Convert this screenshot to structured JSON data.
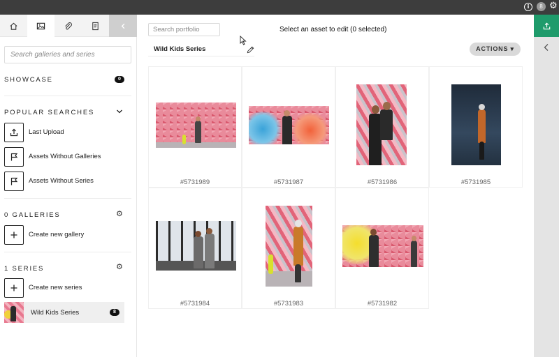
{
  "topbar": {
    "notification_count": "8",
    "icons": [
      "info-icon",
      "notification-badge",
      "gear-icon"
    ]
  },
  "sidebar": {
    "tabs": [
      "home-icon",
      "image-icon",
      "attachment-icon",
      "document-icon",
      "chevron-left-icon"
    ],
    "search_placeholder": "Search galleries and series",
    "showcase": {
      "title": "SHOWCASE",
      "count": "0"
    },
    "popular_searches": {
      "title": "POPULAR SEARCHES",
      "items": [
        {
          "label": "Last Upload",
          "icon": "upload-icon"
        },
        {
          "label": "Assets Without Galleries",
          "icon": "flag-icon"
        },
        {
          "label": "Assets Without Series",
          "icon": "flag-icon"
        }
      ]
    },
    "galleries": {
      "title": "0 GALLERIES",
      "create_label": "Create new gallery"
    },
    "series": {
      "title": "1 SERIES",
      "create_label": "Create new series",
      "items": [
        {
          "label": "Wild Kids Series",
          "count": "8"
        }
      ]
    }
  },
  "main": {
    "search_placeholder": "Search portfolio",
    "selection_message": "Select an asset to edit (0 selected)",
    "series_name": "Wild Kids Series",
    "actions_label": "ACTIONS ▾",
    "assets": [
      {
        "id": "#5731989"
      },
      {
        "id": "#5731987"
      },
      {
        "id": "#5731986"
      },
      {
        "id": "#5731985"
      },
      {
        "id": "#5731984"
      },
      {
        "id": "#5731983"
      },
      {
        "id": "#5731982"
      }
    ]
  },
  "rail": {
    "icons": [
      "upload-icon",
      "chevron-left-icon"
    ],
    "accent_color": "#1f9b6b"
  }
}
